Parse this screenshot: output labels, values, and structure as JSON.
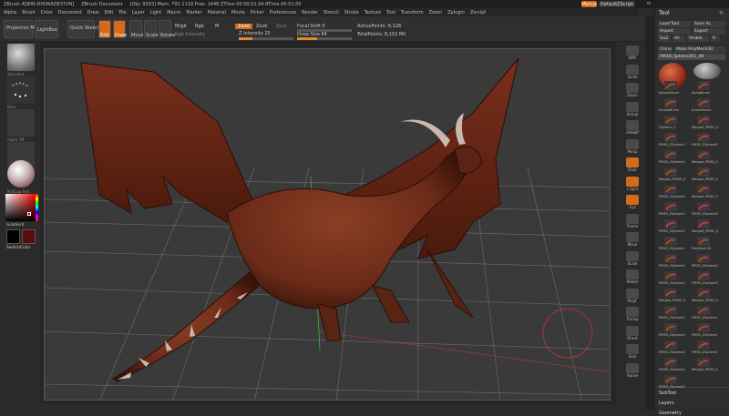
{
  "titlebar": {
    "app": "ZBrush 4[WIN-DHOKADE37VN]",
    "doc": "ZBrush Document",
    "stats": "[Obj: 9593]  Mem: 791-1118  Free: 1448  ZTime 00:00:01.04  RTime 00:01:00",
    "menus_btn": "Menus",
    "script_btn": "DefaultZScript"
  },
  "menubar": [
    "Alpha",
    "Brush",
    "Color",
    "Document",
    "Draw",
    "Edit",
    "File",
    "Layer",
    "Light",
    "Macro",
    "Marker",
    "Material",
    "Movie",
    "Picker",
    "Preferences",
    "Render",
    "Stencil",
    "Stroke",
    "Texture",
    "Tool",
    "Transform",
    "Zoom",
    "Zplugin",
    "Zscript"
  ],
  "toolbar": {
    "projection": "Projection Master",
    "lightbox": "LightBox",
    "quicksketch": "Quick Sketch",
    "edit": "Edit",
    "draw": "Draw",
    "move": "Move",
    "scale": "Scale",
    "rotate": "Rotate",
    "mrgb": "Mrgb",
    "rgb": "Rgb",
    "m": "M",
    "rgb_intensity": "Rgb Intensity",
    "zadd": "Zadd",
    "zsub": "Zsub",
    "zcut": "Zcut",
    "z_intensity": "Z Intensity 25",
    "focal_shift": "Focal Shift 0",
    "draw_size": "Draw Size 64",
    "active_points": "ActivePoints: 8,128",
    "total_points": "TotalPoints: 8,102 Mil",
    "z_intensity_level": 0.25,
    "draw_size_level": 0.36
  },
  "leftshelf": {
    "gradient": "Gradient",
    "switchcolor": "SwitchColor",
    "labels": [
      "Standard",
      "Dots",
      "Alpha Off",
      "Texture Off",
      "MatCap Red"
    ]
  },
  "rightshelf": [
    "BPR",
    "Scroll",
    "Zoom",
    "Actual",
    "AAHalf",
    "Persp",
    "Floor",
    "L.Sym",
    "Xyz",
    "Frame",
    "Move",
    "Scale",
    "Rotate",
    "PolyF",
    "Transp",
    "Ghost",
    "Solo",
    "Xpose"
  ],
  "toolpanel": {
    "title": "Tool",
    "load_tool": "Load Tool",
    "save_as": "Save As",
    "import": "Import",
    "export": "Export",
    "clone": "Clone",
    "make_polymesh": "Make PolyMesh3D",
    "goz": "GoZ",
    "all": "All",
    "visible": "Visible",
    "r": "R",
    "current_tool": "PM3D_Sphere3D1_48",
    "tools": [
      "SphereBrush",
      "AlphaBrush",
      "SimpleBrush",
      "EraserBrush",
      "ZSphere_1",
      "Merged_PM3D_S",
      "PM3D_ZSphere1",
      "PM3D_ZSphere3",
      "PM3D_ZSphere1",
      "Merged_PM3D_Z",
      "Merged_PM3D_Z",
      "Merged_PM3D_Z",
      "PM3D_ZSphere2",
      "Merged_PM3D_Z",
      "PM3D_ZSphere1",
      "PM3D_ZSphere3",
      "PM3D_ZSphere1",
      "Merged_PM3D_Z",
      "PM3D_ZSphere1",
      "PolyMesh3D",
      "PM3D_ZSphere1",
      "PM3D_ZSphere2",
      "PM3D_ZSphere1",
      "PM3D_ZSphere3",
      "Merged_PM3D_Z",
      "Merged_PM3D_Z",
      "PM3D_ZSphere1",
      "PM3D_ZSphere1",
      "PM3D_ZSphere2",
      "PM3D_ZSphere1",
      "PM3D_ZSphere2",
      "PM3D_ZSphere1",
      "PM3D_ZSphere1",
      "Merged_PM3D_S",
      "PM3D_ZSphere1"
    ],
    "subtool": "SubTool",
    "layers": "Layers",
    "geometry": "Geometry"
  },
  "colors": {
    "accent": "#e08a2a",
    "model": "#7a3420",
    "bg": "#3a3a3a"
  }
}
